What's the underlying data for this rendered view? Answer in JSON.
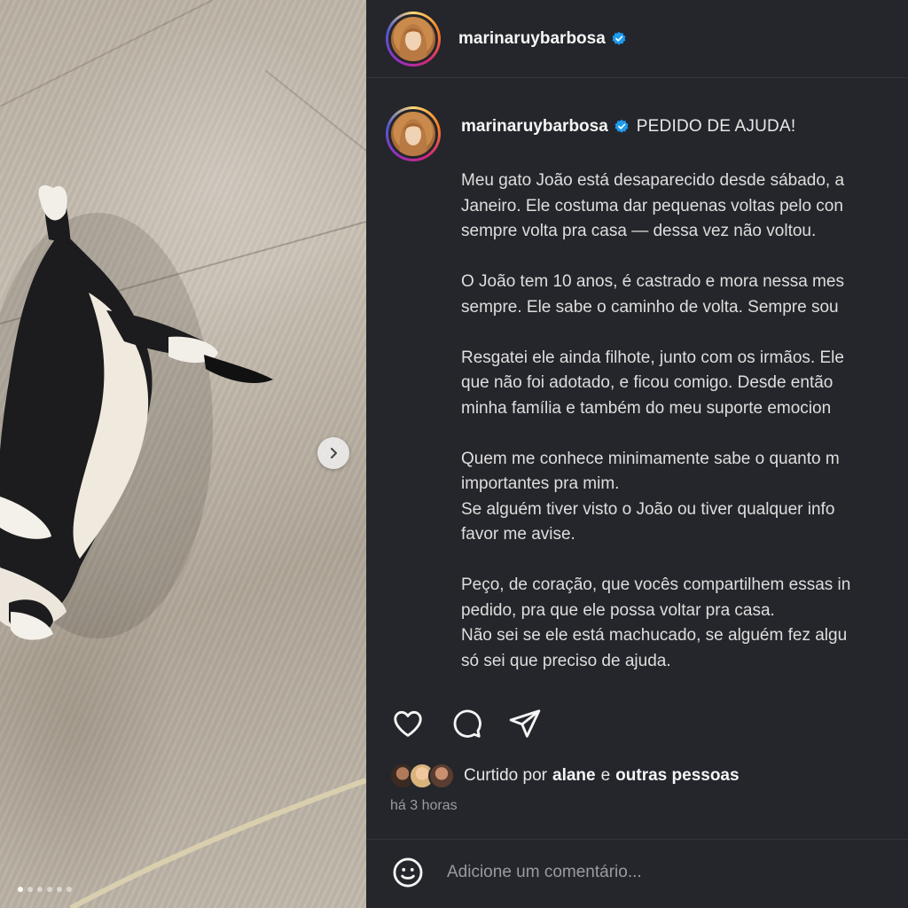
{
  "post": {
    "username": "marinaruybarbosa",
    "verified": true
  },
  "caption": {
    "username": "marinaruybarbosa",
    "lead": "PEDIDO DE AJUDA!",
    "paragraphs": [
      [
        "Meu gato João está desaparecido desde sábado, a",
        "Janeiro. Ele costuma dar pequenas voltas pelo con",
        "sempre volta pra casa — dessa vez não voltou."
      ],
      [
        "O João tem 10 anos, é castrado e mora nessa mes",
        "sempre. Ele sabe o caminho de volta. Sempre sou"
      ],
      [
        "Resgatei ele ainda filhote, junto com os irmãos. Ele",
        "que não foi adotado, e ficou comigo. Desde então",
        "minha família e também do meu suporte emocion"
      ],
      [
        "Quem me conhece minimamente sabe o quanto m",
        "importantes pra mim.",
        "Se alguém tiver visto o João ou tiver qualquer info",
        "favor me avise."
      ],
      [
        "Peço, de coração, que vocês compartilhem essas in",
        "pedido, pra que ele possa voltar pra casa.",
        "Não sei se ele está machucado, se alguém fez algu",
        "só sei que preciso de ajuda."
      ]
    ]
  },
  "likes": {
    "prefix": "Curtido por",
    "user": "alane",
    "joiner": "e",
    "others": "outras pessoas"
  },
  "timestamp": "há 3 horas",
  "comment": {
    "placeholder": "Adicione um comentário..."
  },
  "icons": {
    "verified": "verified-badge-icon",
    "like": "heart-icon",
    "comment": "comment-bubble-icon",
    "share": "paper-plane-icon",
    "emoji": "smiley-icon",
    "next": "chevron-right-icon"
  },
  "colors": {
    "panel_bg": "#25262b",
    "verified_blue": "#1d9bf0",
    "text": "#f5f5f5",
    "muted": "#9a9aa0"
  },
  "carousel": {
    "slides": 6,
    "active": 0
  }
}
